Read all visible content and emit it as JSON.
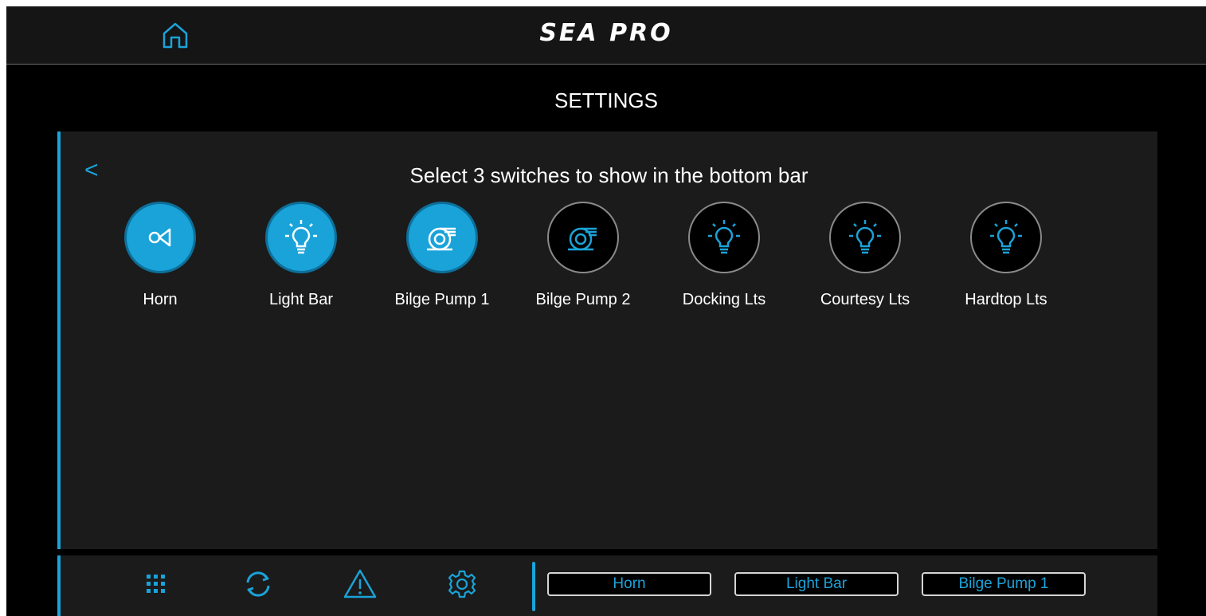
{
  "header": {
    "brand": "SEA PRO",
    "home_icon": "home-icon"
  },
  "page": {
    "title": "SETTINGS"
  },
  "panel": {
    "back_label": "<",
    "instruction": "Select 3 switches to show in the bottom bar",
    "switches": [
      {
        "label": "Horn",
        "icon": "horn-icon",
        "selected": true
      },
      {
        "label": "Light Bar",
        "icon": "light-bulb-icon",
        "selected": true
      },
      {
        "label": "Bilge Pump 1",
        "icon": "bilge-pump-icon",
        "selected": true
      },
      {
        "label": "Bilge Pump 2",
        "icon": "bilge-pump-icon",
        "selected": false
      },
      {
        "label": "Docking Lts",
        "icon": "light-bulb-icon",
        "selected": false
      },
      {
        "label": "Courtesy Lts",
        "icon": "light-bulb-icon",
        "selected": false
      },
      {
        "label": "Hardtop Lts",
        "icon": "light-bulb-icon",
        "selected": false
      }
    ]
  },
  "bottom_bar": {
    "nav": [
      {
        "icon": "grid-icon"
      },
      {
        "icon": "refresh-icon"
      },
      {
        "icon": "warning-icon"
      },
      {
        "icon": "gear-icon"
      }
    ],
    "quick_switches": [
      "Horn",
      "Light Bar",
      "Bilge Pump 1"
    ]
  },
  "colors": {
    "accent": "#1aa3d8",
    "background": "#000000",
    "panel": "#1b1b1b",
    "header": "#151515"
  }
}
